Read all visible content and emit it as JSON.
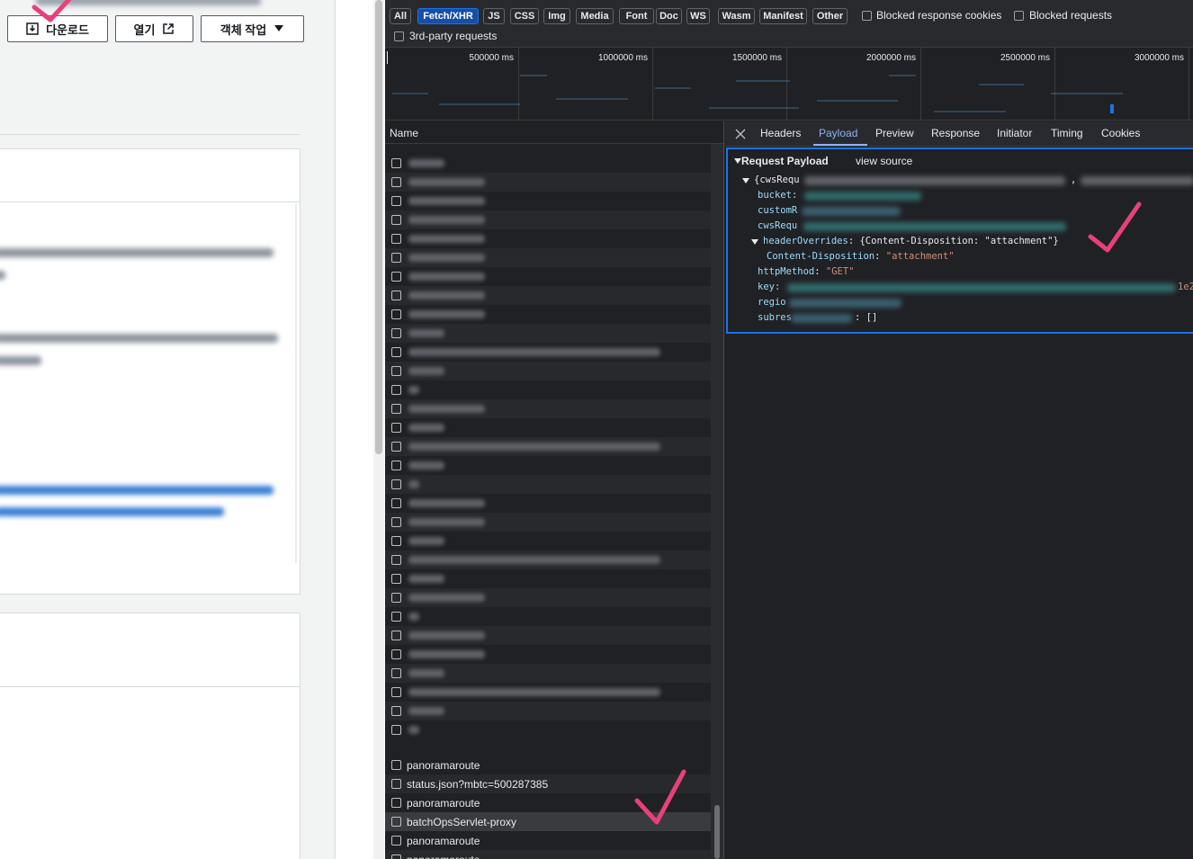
{
  "s3": {
    "download_button": "다운로드",
    "open_button": "열기",
    "object_actions_button": "객체 작업"
  },
  "devtools": {
    "filters": [
      "All",
      "Fetch/XHR",
      "JS",
      "CSS",
      "Img",
      "Media",
      "Font",
      "Doc",
      "WS",
      "Wasm",
      "Manifest",
      "Other"
    ],
    "active_filter": "Fetch/XHR",
    "blocked_response_cookies": "Blocked response cookies",
    "blocked_requests": "Blocked requests",
    "third_party_requests": "3rd-party requests",
    "timeline_ticks": [
      "500000 ms",
      "1000000 ms",
      "1500000 ms",
      "2000000 ms",
      "2500000 ms",
      "3000000 ms"
    ],
    "name_header": "Name",
    "visible_requests": [
      "panoramaroute",
      "status.json?mbtc=500287385",
      "panoramaroute",
      "batchOpsServlet-proxy",
      "panoramaroute",
      "panoramaroute"
    ],
    "selected_request": "batchOpsServlet-proxy",
    "tabs": [
      "Headers",
      "Payload",
      "Preview",
      "Response",
      "Initiator",
      "Timing",
      "Cookies"
    ],
    "active_tab": "Payload",
    "payload": {
      "section_title": "Request Payload",
      "view_source": "view source",
      "root_prefix": "{cwsRequ",
      "root_comma": ",",
      "bucket_key": "bucket",
      "custom_key": "customR",
      "cws_key": "cwsRequ",
      "header_overrides_key": "headerOverrides",
      "header_overrides_value": "{Content-Disposition: \"attachment\"}",
      "content_disposition_key": "Content-Disposition",
      "content_disposition_value": "\"attachment\"",
      "http_method_key": "httpMethod",
      "http_method_value": "\"GET\"",
      "key_key": "key",
      "key_tail": "1e2",
      "region_key": "regio",
      "subresource_key": "subres",
      "subresource_tail": "[]"
    }
  }
}
